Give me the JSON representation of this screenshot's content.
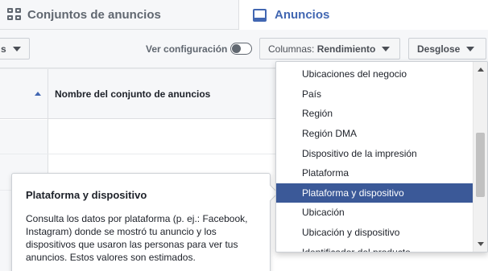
{
  "tabs": {
    "adsets_label": "Conjuntos de anuncios",
    "ads_label": "Anuncios"
  },
  "toolbar": {
    "left_button_label": "s",
    "view_config_label": "Ver configuración",
    "columns_prefix": "Columnas:",
    "columns_value": "Rendimiento",
    "breakdown_label": "Desglose"
  },
  "table": {
    "column_title": "Nombre del conjunto de anuncios"
  },
  "tooltip": {
    "title": "Plataforma y dispositivo",
    "body": "Consulta los datos por plataforma (p. ej.: Facebook, Instagram) donde se mostró tu anuncio y los dispositivos que usaron las personas para ver tus anuncios. Estos valores son estimados."
  },
  "dropdown": {
    "items": [
      "Ubicaciones del negocio",
      "País",
      "Región",
      "Región DMA",
      "Dispositivo de la impresión",
      "Plataforma",
      "Plataforma y dispositivo",
      "Ubicación",
      "Ubicación y dispositivo",
      "Identificador del producto"
    ],
    "selected_index": 6
  },
  "colors": {
    "brand": "#4267b2",
    "selected_bg": "#3b5998"
  },
  "icons": {
    "adsets_tab": "grid-icon",
    "ads_tab": "ad-icon",
    "sort": "sort-up-icon",
    "dropdown_caret": "caret-down-icon"
  }
}
